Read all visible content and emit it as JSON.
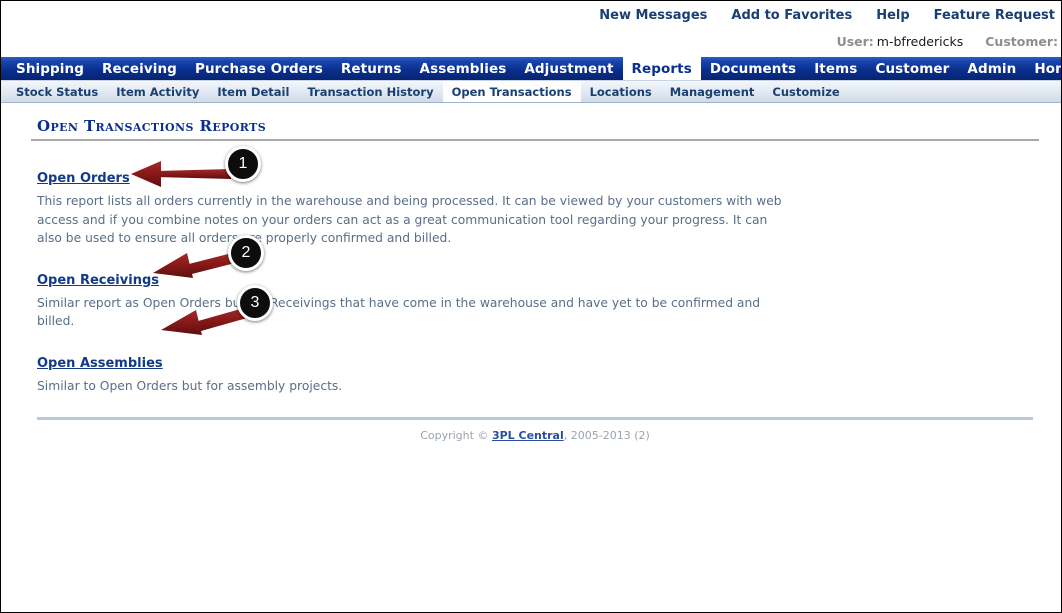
{
  "top_links": [
    {
      "label": "New Messages"
    },
    {
      "label": "Add to Favorites"
    },
    {
      "label": "Help"
    },
    {
      "label": "Feature Request"
    }
  ],
  "user_strip": {
    "user_label": "User:",
    "user_value": "m-bfredericks",
    "customer_label": "Customer:",
    "customer_value": ""
  },
  "main_nav": {
    "active": "Reports",
    "items": [
      {
        "label": "Shipping"
      },
      {
        "label": "Receiving"
      },
      {
        "label": "Purchase Orders"
      },
      {
        "label": "Returns"
      },
      {
        "label": "Assemblies"
      },
      {
        "label": "Adjustment"
      },
      {
        "label": "Reports"
      },
      {
        "label": "Documents"
      },
      {
        "label": "Items"
      },
      {
        "label": "Customer"
      },
      {
        "label": "Admin"
      },
      {
        "label": "Home"
      }
    ]
  },
  "sub_nav": {
    "active": "Open Transactions",
    "items": [
      {
        "label": "Stock Status"
      },
      {
        "label": "Item Activity"
      },
      {
        "label": "Item Detail"
      },
      {
        "label": "Transaction History"
      },
      {
        "label": "Open Transactions"
      },
      {
        "label": "Locations"
      },
      {
        "label": "Management"
      },
      {
        "label": "Customize"
      }
    ]
  },
  "page": {
    "title": "Open Transactions Reports"
  },
  "reports": [
    {
      "link": "Open Orders",
      "description": "This report lists all orders currently in the warehouse and being processed. It can be viewed by your customers with web access and if you combine notes on your orders can act as a great communication tool regarding your progress. It can also be used to ensure all orders are properly confirmed and billed."
    },
    {
      "link": "Open Receivings",
      "description": "Similar report as Open Orders but for Receivings that have come in the warehouse and have yet to be confirmed and billed."
    },
    {
      "link": "Open Assemblies",
      "description": "Similar to Open Orders but for assembly projects."
    }
  ],
  "footer": {
    "prefix": "Copyright ©",
    "link": "3PL Central",
    "suffix": ", 2005-2013 (2)"
  },
  "annotations": {
    "arrow_color": "#8B1A1A",
    "badge_bg": "#0d0d0d",
    "badge_text_color": "#ffffff",
    "callouts": [
      {
        "number": "1"
      },
      {
        "number": "2"
      },
      {
        "number": "3"
      }
    ]
  },
  "colors": {
    "nav_blue": "#0b2f8f",
    "link_blue": "#123a87",
    "body_text": "#5a6e87",
    "muted": "#9aa3ad"
  }
}
